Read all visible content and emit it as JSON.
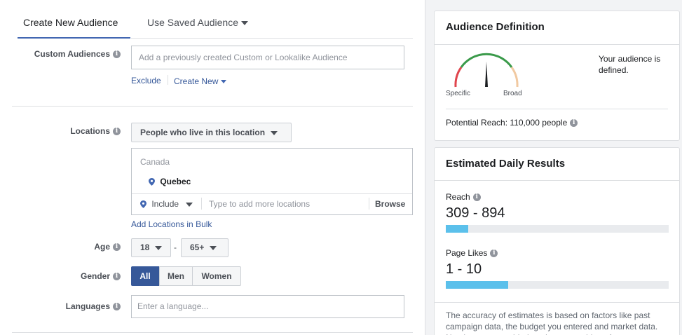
{
  "tabs": {
    "create_new": "Create New Audience",
    "use_saved": "Use Saved Audience"
  },
  "custom_audiences": {
    "label": "Custom Audiences",
    "placeholder": "Add a previously created Custom or Lookalike Audience",
    "exclude": "Exclude",
    "create_new": "Create New"
  },
  "locations": {
    "label": "Locations",
    "dropdown": "People who live in this location",
    "country": "Canada",
    "selected": "Quebec",
    "include": "Include",
    "placeholder": "Type to add more locations",
    "browse": "Browse",
    "bulk_link": "Add Locations in Bulk"
  },
  "age": {
    "label": "Age",
    "min": "18",
    "separator": "-",
    "max": "65+"
  },
  "gender": {
    "label": "Gender",
    "options": [
      "All",
      "Men",
      "Women"
    ],
    "selected": "All"
  },
  "languages": {
    "label": "Languages",
    "placeholder": "Enter a language..."
  },
  "audience_definition": {
    "title": "Audience Definition",
    "gauge_left": "Specific",
    "gauge_right": "Broad",
    "status_text": "Your audience is defined.",
    "potential_reach": "Potential Reach: 110,000 people"
  },
  "daily_results": {
    "title": "Estimated Daily Results",
    "reach_label": "Reach",
    "reach_value": "309 - 894",
    "reach_fill": 0.1,
    "likes_label": "Page Likes",
    "likes_value": "1 - 10",
    "likes_fill": 0.28,
    "disclaimer": "The accuracy of estimates is based on factors like past campaign data, the budget you entered and market data. Numbers are provided to give you an idea of"
  },
  "colors": {
    "primary": "#4267b2",
    "link": "#365899",
    "bar_fill": "#5bc0eb",
    "gauge_red": "#e0454d",
    "gauge_green": "#3a9a4a",
    "gauge_tan": "#f1c9a1"
  }
}
